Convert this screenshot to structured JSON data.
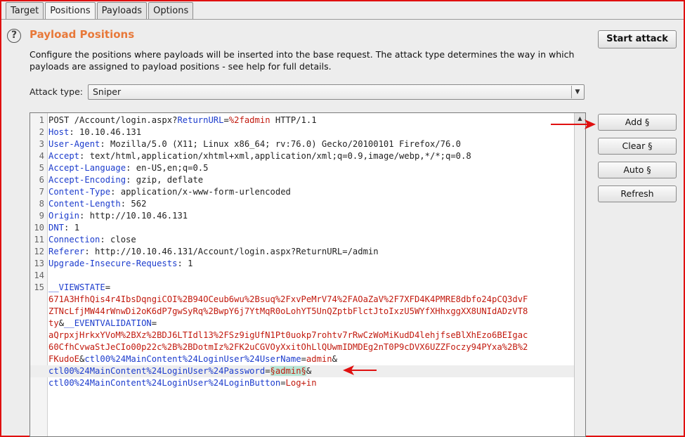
{
  "tabs": [
    {
      "label": "Target"
    },
    {
      "label": "Positions"
    },
    {
      "label": "Payloads"
    },
    {
      "label": "Options"
    }
  ],
  "header": {
    "title": "Payload Positions",
    "description": "Configure the positions where payloads will be inserted into the base request. The attack type determines the way in which payloads are assigned to payload positions - see help for full details."
  },
  "buttons": {
    "start_attack": "Start attack",
    "add": "Add §",
    "clear": "Clear §",
    "auto": "Auto §",
    "refresh": "Refresh"
  },
  "attack_type": {
    "label": "Attack type:",
    "value": "Sniper"
  },
  "request": {
    "line1": {
      "num": "1",
      "method": "POST /Account/login.aspx?",
      "param": "ReturnURL",
      "eq": "=",
      "value": "%2fadmin",
      "tail": " HTTP/1.1"
    },
    "headers": [
      {
        "num": "2",
        "name": "Host",
        "value": ": 10.10.46.131"
      },
      {
        "num": "3",
        "name": "User-Agent",
        "value": ": Mozilla/5.0 (X11; Linux x86_64; rv:76.0) Gecko/20100101 Firefox/76.0"
      },
      {
        "num": "4",
        "name": "Accept",
        "value": ": text/html,application/xhtml+xml,application/xml;q=0.9,image/webp,*/*;q=0.8"
      },
      {
        "num": "5",
        "name": "Accept-Language",
        "value": ": en-US,en;q=0.5"
      },
      {
        "num": "6",
        "name": "Accept-Encoding",
        "value": ": gzip, deflate"
      },
      {
        "num": "7",
        "name": "Content-Type",
        "value": ": application/x-www-form-urlencoded"
      },
      {
        "num": "8",
        "name": "Content-Length",
        "value": ": 562"
      },
      {
        "num": "9",
        "name": "Origin",
        "value": ": http://10.10.46.131"
      },
      {
        "num": "10",
        "name": "DNT",
        "value": ": 1"
      },
      {
        "num": "11",
        "name": "Connection",
        "value": ": close"
      },
      {
        "num": "12",
        "name": "Referer",
        "value": ": http://10.10.46.131/Account/login.aspx?ReturnURL=/admin"
      },
      {
        "num": "13",
        "name": "Upgrade-Insecure-Requests",
        "value": ": 1"
      }
    ],
    "blank_num": "14",
    "body_num": "15",
    "body": {
      "viewstate_name": "__VIEWSTATE",
      "viewstate_eq": "=",
      "viewstate_1": "671A3HfhQis4r4IbsDqngiCOI%2B94OCeub6wu%2Bsuq%2FxvPeMrV74%2FAOaZaV%2F7XFD4K4PMRE8dbfo24pCQ3dvF",
      "viewstate_2": "ZTNcLfjMW44rWnwDi2oK6dP7gwSyRq%2BwpY6j7YtMqR0oLohYT5UnQZptbFlctJtoIxzU5WYfXHhxggXX8UNIdADzVT8",
      "viewstate_3": "ty",
      "amp1": "&",
      "eventval_name": "__EVENTVALIDATION",
      "eventval_eq": "=",
      "eventval_1": "aQrpxjHrkxYVoM%2BXz%2BDJ6LTIdl13%2FSz9igUfN1Pt0uokp7rohtv7rRwCzWoMiKudD4lehjfseBlXhEzo6BEIgac",
      "eventval_2": "60CfhCvwaStJeCIo00p22c%2B%2BDotmIz%2FK2uCGVOyXxitOhLlQUwmIDMDEg2nT0P9cDVX6UZZFoczy94PYxa%2B%2",
      "eventval_3": "FKudoE",
      "amp2": "&",
      "username_name": "ctl00%24MainContent%24LoginUser%24UserName",
      "username_eq": "=",
      "username_value": "admin",
      "amp3": "&",
      "password_name": "ctl00%24MainContent%24LoginUser%24Password",
      "password_eq": "=",
      "password_value": "§admin§",
      "amp4": "&",
      "button_name": "ctl00%24MainContent%24LoginUser%24LoginButton",
      "button_eq": "=",
      "button_value": "Log+in"
    }
  },
  "icons": {
    "help": "help-icon",
    "dropdown": "chevron-down-icon",
    "scroll_up": "scroll-up-icon",
    "annotation": "red-arrow-icon"
  },
  "colors": {
    "title": "#e8793a",
    "header_name": "#1c3ccd",
    "param_value": "#c21a0e",
    "payload_marker_bg": "#b8e6d6",
    "annotation": "#e01010"
  }
}
